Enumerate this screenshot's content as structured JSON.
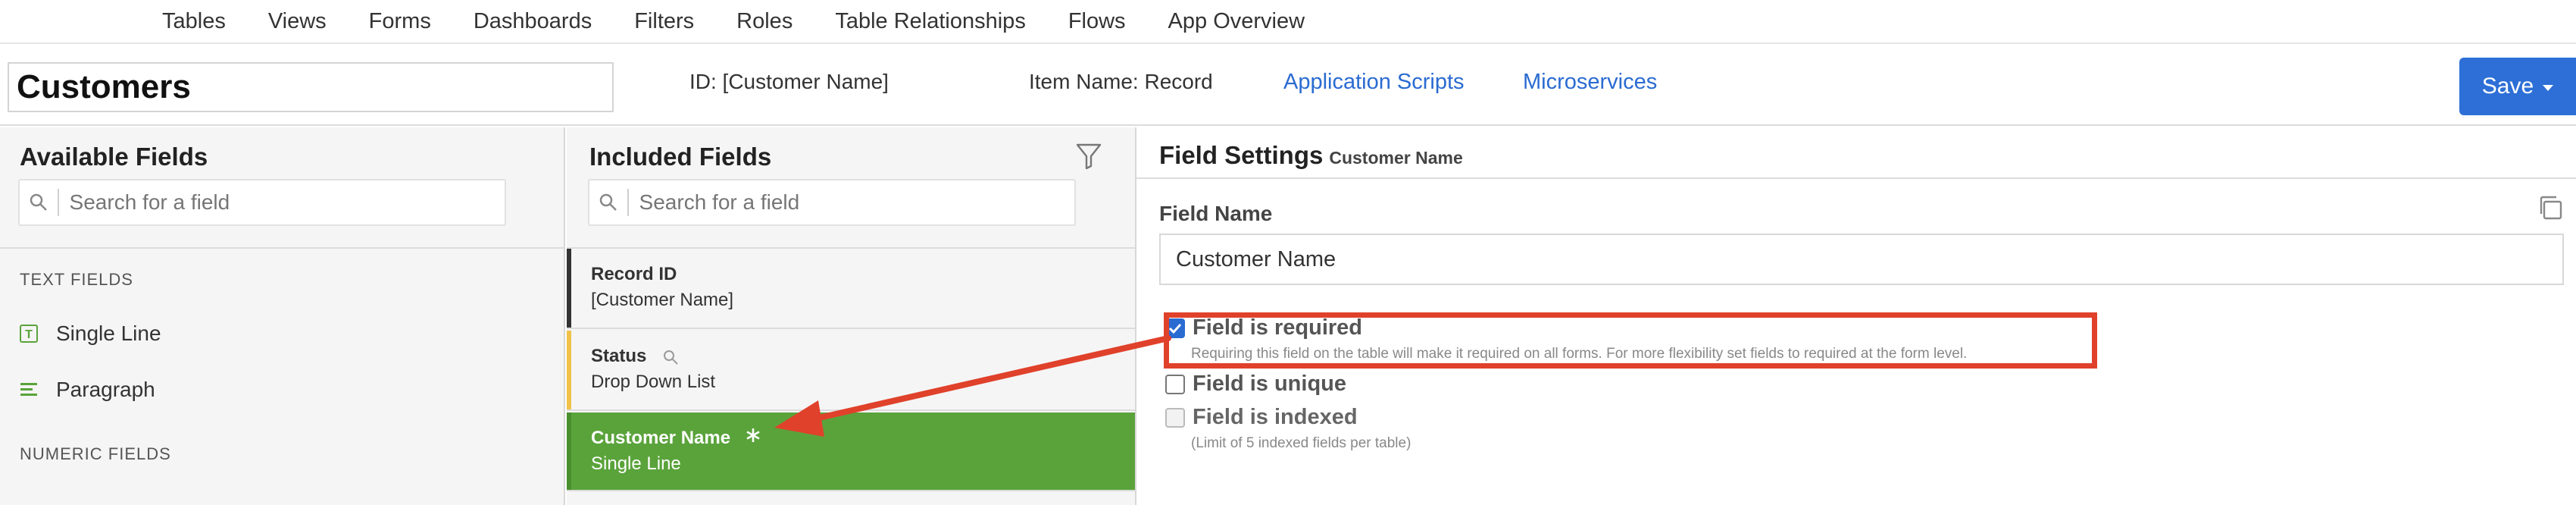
{
  "nav": {
    "items": [
      "Tables",
      "Views",
      "Forms",
      "Dashboards",
      "Filters",
      "Roles",
      "Table Relationships",
      "Flows",
      "App Overview"
    ]
  },
  "header": {
    "title": "Customers",
    "id_text": "ID: [Customer Name]",
    "item_name_text": "Item Name: Record",
    "link_scripts": "Application Scripts",
    "link_microservices": "Microservices",
    "save_label": "Save"
  },
  "available": {
    "title": "Available Fields",
    "search_placeholder": "Search for a field",
    "cat_text": "TEXT FIELDS",
    "items": [
      "Single Line",
      "Paragraph"
    ],
    "cat_numeric": "NUMERIC FIELDS"
  },
  "included": {
    "title": "Included Fields",
    "search_placeholder": "Search for a field",
    "items": [
      {
        "name": "Record ID",
        "type": "[Customer Name]",
        "bar": "#333333"
      },
      {
        "name": "Status",
        "type": "Drop Down List",
        "bar": "#f0c24a"
      },
      {
        "name": "Customer Name",
        "type": "Single Line",
        "bar": "#5aa33b"
      }
    ]
  },
  "settings": {
    "title": "Field Settings",
    "subtitle": "Customer Name",
    "field_name_label": "Field Name",
    "field_name_value": "Customer Name",
    "required_label": "Field is required",
    "required_help": "Requiring this field on the table will make it required on all forms. For more flexibility set fields to required at the form level.",
    "unique_label": "Field is unique",
    "indexed_label": "Field is indexed",
    "indexed_help": "(Limit of 5 indexed fields per table)",
    "required_checked": true,
    "unique_checked": false,
    "indexed_checked": false
  },
  "colors": {
    "accent": "#2d6fd6",
    "selected": "#5aa33b",
    "annotation": "#e0412b"
  }
}
